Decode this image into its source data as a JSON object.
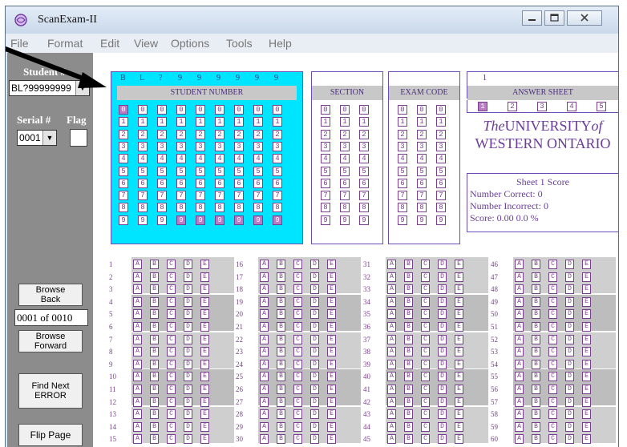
{
  "window": {
    "title": "ScanExam-II"
  },
  "menu": [
    "File",
    "Format",
    "Edit",
    "View",
    "Options",
    "Tools",
    "Help"
  ],
  "panel": {
    "student_label": "Student #",
    "student_value": "BL?99999999",
    "serial_label": "Serial #",
    "flag_label": "Flag",
    "serial_value": "0001",
    "browse_back": "Browse\nBack",
    "record_position": "0001 of 0010",
    "browse_forward": "Browse\nForward",
    "find_next_error": "Find Next\nERROR",
    "flip_page": "Flip Page"
  },
  "sheet": {
    "student_digits": [
      "B",
      "L",
      "?",
      "9",
      "9",
      "9",
      "9",
      "9",
      "9"
    ],
    "student_number_label": "STUDENT NUMBER",
    "section_label": "SECTION",
    "exam_code_label": "EXAM CODE",
    "answer_sheet_value": "1",
    "answer_sheet_label": "ANSWER SHEET",
    "answer_sheet_options": [
      "1",
      "2",
      "3",
      "4",
      "5"
    ],
    "university_line1_italic": "The",
    "university_line1_name": "UNIVERSITY",
    "university_line1_of": "of",
    "university_line2": "WESTERN ONTARIO",
    "score_title": "Sheet 1 Score",
    "number_correct": "Number Correct:  0",
    "number_incorrect": "Number Incorrect:  0",
    "score": "Score:  0.00   0.0 %",
    "digits": [
      "0",
      "1",
      "2",
      "3",
      "4",
      "5",
      "6",
      "7",
      "8",
      "9"
    ],
    "choices": [
      "A",
      "B",
      "C",
      "D",
      "E"
    ],
    "question_columns": [
      [
        "1",
        "2",
        "3",
        "4",
        "5",
        "6",
        "7",
        "8",
        "9",
        "10",
        "11",
        "12",
        "13",
        "14",
        "15"
      ],
      [
        "16",
        "17",
        "18",
        "19",
        "20",
        "21",
        "22",
        "23",
        "24",
        "25",
        "26",
        "27",
        "28",
        "29",
        "30"
      ],
      [
        "31",
        "32",
        "33",
        "34",
        "35",
        "36",
        "37",
        "38",
        "39",
        "40",
        "41",
        "42",
        "43",
        "44",
        "45"
      ],
      [
        "46",
        "47",
        "48",
        "49",
        "50",
        "51",
        "52",
        "53",
        "54",
        "55",
        "56",
        "57",
        "58",
        "59",
        "60"
      ]
    ]
  },
  "colors": {
    "cyan_panel": "#00e5ff",
    "bubble_purple": "#7a3e8e",
    "gray_panel": "#8c8c8c"
  }
}
